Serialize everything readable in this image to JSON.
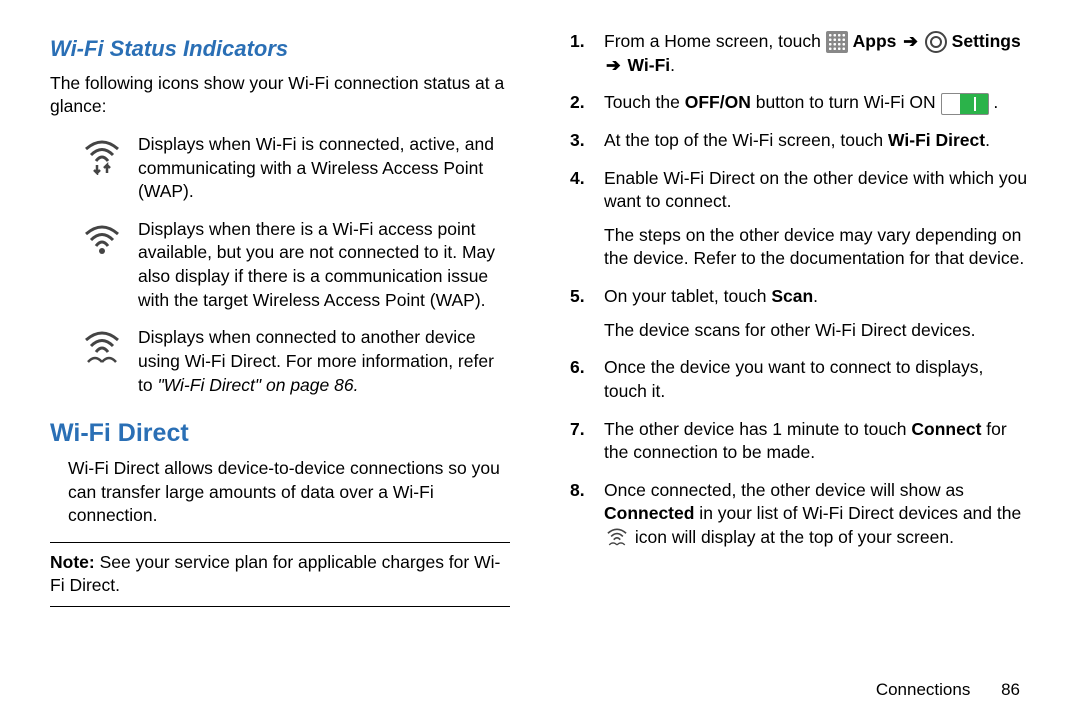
{
  "left": {
    "subheading": "Wi-Fi Status Indicators",
    "intro": "The following icons show your Wi-Fi connection status at a glance:",
    "indicators": [
      {
        "icon": "wifi-connected-icon",
        "text": "Displays when Wi-Fi is connected, active, and communicating with a Wireless Access Point (WAP)."
      },
      {
        "icon": "wifi-available-icon",
        "text": "Displays when there is a Wi-Fi access point available, but you are not connected to it. May also display if there is a communication issue with the target Wireless Access Point (WAP)."
      },
      {
        "icon": "wifi-direct-icon",
        "text_pre": "Displays when connected to another device using Wi-Fi Direct. For more information, refer to ",
        "ref": "\"Wi-Fi Direct\"",
        "text_post": " on page 86."
      }
    ],
    "heading2": "Wi-Fi Direct",
    "direct_intro": "Wi-Fi Direct allows device-to-device connections so you can transfer large amounts of data over a Wi-Fi connection.",
    "note_label": "Note:",
    "note_text": " See your service plan for applicable charges for Wi-Fi Direct."
  },
  "right": {
    "steps": {
      "s1_pre": "From a Home screen, touch ",
      "s1_apps": " Apps ",
      "s1_settings": " Settings ",
      "s1_wifi": " Wi-Fi",
      "s2_pre": "Touch the ",
      "s2_bold": "OFF/ON",
      "s2_mid": " button to turn Wi-Fi ON ",
      "s3_pre": "At the top of the Wi-Fi screen, touch ",
      "s3_bold": "Wi-Fi Direct",
      "s4": "Enable Wi-Fi Direct on the other device with which you want to connect.",
      "s4_sub": "The steps on the other device may vary depending on the device. Refer to the documentation for that device.",
      "s5_pre": "On your tablet, touch ",
      "s5_bold": "Scan",
      "s5_sub": "The device scans for other Wi-Fi Direct devices.",
      "s6": "Once the device you want to connect to displays, touch it.",
      "s7_pre": "The other device has 1 minute to touch ",
      "s7_bold": "Connect",
      "s7_post": " for the connection to be made.",
      "s8_pre": "Once connected, the other device will show as ",
      "s8_bold": "Connected",
      "s8_mid": " in your list of Wi-Fi Direct devices and the ",
      "s8_post": " icon will display at the top of your screen."
    }
  },
  "footer": {
    "section": "Connections",
    "page": "86"
  }
}
